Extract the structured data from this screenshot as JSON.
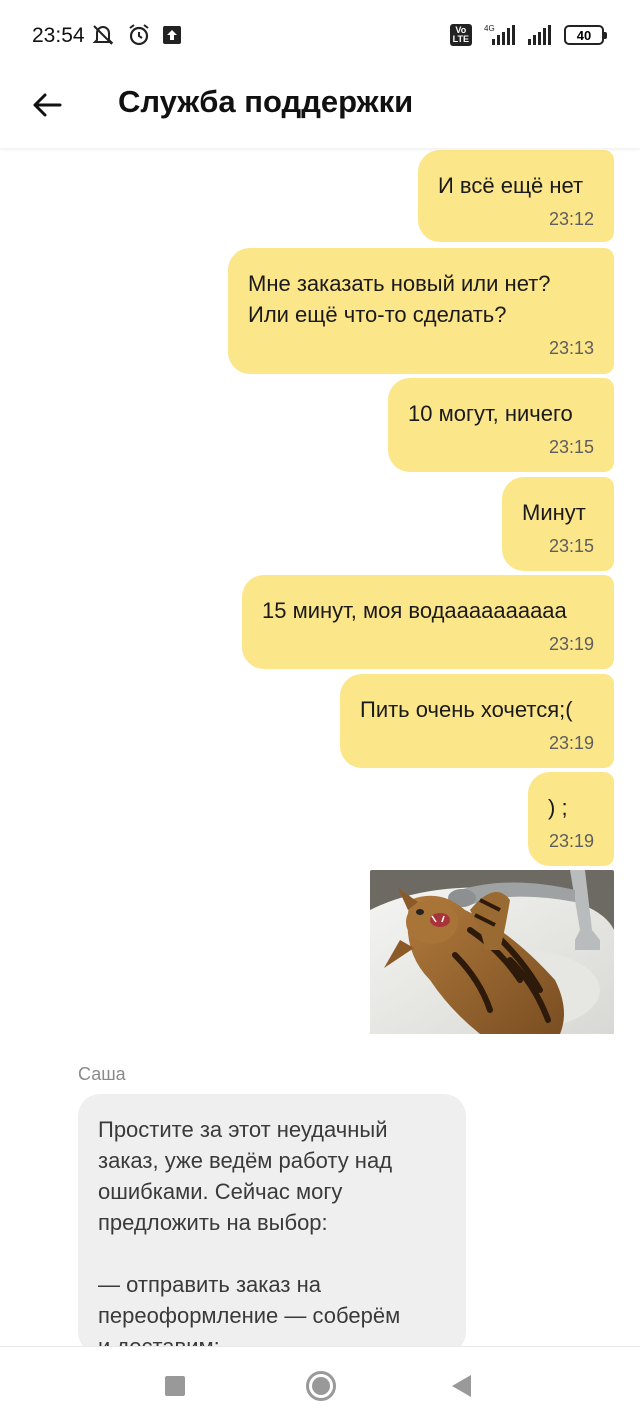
{
  "status_bar": {
    "time": "23:54",
    "network": "4G",
    "volte": "Vo\nLTE",
    "battery": "40"
  },
  "header": {
    "title": "Служба поддержки"
  },
  "messages": [
    {
      "text": "И всё ещё нет",
      "time": "23:12"
    },
    {
      "text": "Мне заказать новый или нет?\nИли ещё что-то сделать?",
      "time": "23:13"
    },
    {
      "text": "10 могут, ничего",
      "time": "23:15"
    },
    {
      "text": "Минут",
      "time": "23:15"
    },
    {
      "text": "15 минут, моя водаааааааааа",
      "time": "23:19"
    },
    {
      "text": "Пить очень хочется;(",
      "time": "23:19"
    },
    {
      "text": ") ;",
      "time": "23:19"
    }
  ],
  "incoming": {
    "sender": "Саша",
    "text": "Простите за этот неудачный\nзаказ, уже ведём работу над\nошибками. Сейчас могу\nпредложить на выбор:\n\n— отправить заказ на\nпереоформление — соберём\nи доставим;"
  },
  "colors": {
    "outgoing_bubble": "#fce68a",
    "incoming_bubble": "#efefef"
  }
}
